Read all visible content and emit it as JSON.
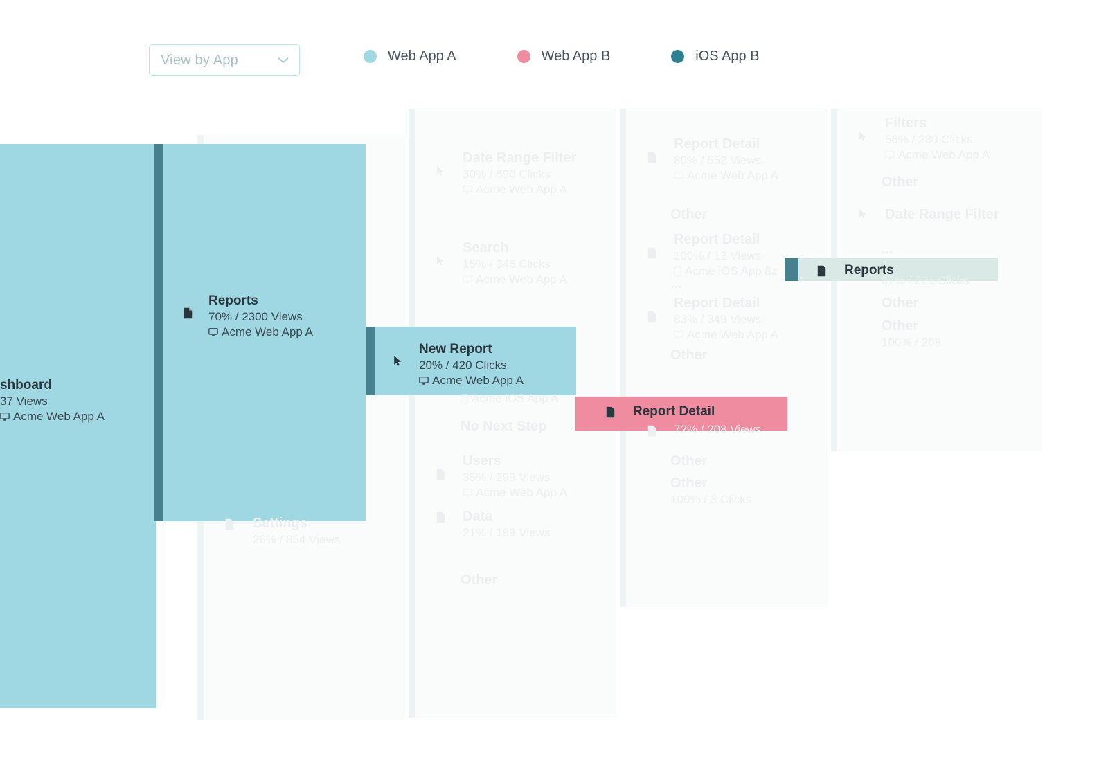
{
  "toolbar": {
    "view_select": {
      "value": "View by App",
      "icon": "chevron-down-icon"
    },
    "legend": [
      {
        "label": "Web App A",
        "color": "#9fd8e2",
        "icon": "legend-dot"
      },
      {
        "label": "Web App B",
        "color": "#ef8ca0",
        "icon": "legend-dot"
      },
      {
        "label": "iOS App B",
        "color": "#2f7f92",
        "icon": "legend-dot"
      }
    ]
  },
  "colors": {
    "flow_web_app_a": "#9fd8e2",
    "flow_web_app_b": "#ef8ca0",
    "flow_ios_app_b": "#2f7f92",
    "connector_bar": "#47818f",
    "highlight_mint": "#d8e9e6",
    "faded_text": "#eceff0",
    "panel_bg": "#fafbfb"
  },
  "flow": {
    "columns": [
      {
        "id": "col-1",
        "nodes": [
          {
            "name": "dashboard",
            "title": "shboard",
            "metric": "37 Views",
            "app": "Acme Web App A",
            "icon": "page-icon",
            "app_icon": "monitor-icon",
            "state": "highlight",
            "color": "#9fd8e2"
          }
        ]
      },
      {
        "id": "col-2",
        "nodes": [
          {
            "name": "reports",
            "title": "Reports",
            "metric": "70% / 2300 Views",
            "app": "Acme Web App A",
            "icon": "page-icon",
            "app_icon": "monitor-icon",
            "state": "highlight",
            "color": "#9fd8e2"
          },
          {
            "name": "settings",
            "title": "Settings",
            "metric": "26% / 854 Views",
            "app": "",
            "icon": "page-icon",
            "app_icon": "",
            "state": "faded"
          }
        ]
      },
      {
        "id": "col-3",
        "nodes": [
          {
            "name": "date-range-filter",
            "title": "Date Range Filter",
            "metric": "30% / 690 Clicks",
            "app": "Acme Web App A",
            "icon": "cursor-icon",
            "app_icon": "monitor-icon",
            "state": "faded"
          },
          {
            "name": "search",
            "title": "Search",
            "metric": "15% / 345 Clicks",
            "app": "Acme Web App A",
            "icon": "cursor-icon",
            "app_icon": "monitor-icon",
            "state": "faded"
          },
          {
            "name": "new-report",
            "title": "New Report",
            "metric": "20% / 420 Clicks",
            "app": "Acme Web App A",
            "icon": "cursor-icon",
            "app_icon": "monitor-icon",
            "state": "highlight",
            "color": "#9fd8e2"
          },
          {
            "name": "acme-ios-app-a",
            "title": "",
            "metric": "",
            "app": "Acme iOS App A",
            "icon": "",
            "app_icon": "mobile-icon",
            "state": "faded"
          },
          {
            "name": "no-next-step",
            "title": "No Next Step",
            "metric": "",
            "app": "",
            "icon": "",
            "app_icon": "",
            "state": "faded"
          },
          {
            "name": "users",
            "title": "Users",
            "metric": "35% / 299 Views",
            "app": "Acme Web App A",
            "icon": "page-icon",
            "app_icon": "monitor-icon",
            "state": "faded"
          },
          {
            "name": "data",
            "title": "Data",
            "metric": "21% / 189 Views",
            "app": "",
            "icon": "page-icon",
            "app_icon": "",
            "state": "faded"
          },
          {
            "name": "other-col3",
            "title": "Other",
            "metric": "",
            "app": "",
            "icon": "",
            "app_icon": "",
            "state": "faded"
          }
        ]
      },
      {
        "id": "col-4",
        "nodes": [
          {
            "name": "report-detail-552",
            "title": "Report Detail",
            "metric": "80% / 552 Views",
            "app": "Acme Web App A",
            "icon": "page-icon",
            "app_icon": "monitor-icon",
            "state": "faded"
          },
          {
            "name": "other-col4-a",
            "title": "Other",
            "metric": "",
            "app": "",
            "icon": "",
            "app_icon": "",
            "state": "faded"
          },
          {
            "name": "report-detail-12",
            "title": "Report Detail",
            "metric": "100% / 12 Views",
            "app": "Acme iOS App 8z",
            "icon": "page-icon",
            "app_icon": "mobile-icon",
            "state": "faded"
          },
          {
            "name": "ellipsis-col4",
            "title": "...",
            "metric": "",
            "app": "",
            "icon": "",
            "app_icon": "",
            "state": "faded"
          },
          {
            "name": "report-detail-349",
            "title": "Report Detail",
            "metric": "83% / 349 Views",
            "app": "Acme Web App A",
            "icon": "page-icon",
            "app_icon": "monitor-icon",
            "state": "faded"
          },
          {
            "name": "other-col4-b",
            "title": "Other",
            "metric": "",
            "app": "",
            "icon": "",
            "app_icon": "",
            "state": "faded"
          },
          {
            "name": "report-detail-highlight",
            "title": "Report Detail",
            "metric": "",
            "app": "",
            "icon": "page-icon",
            "app_icon": "",
            "state": "highlight",
            "color": "#ef8ca0"
          },
          {
            "name": "report-detail-208",
            "title": "",
            "metric": "72% / 208 Views",
            "app": "",
            "icon": "page-icon",
            "app_icon": "",
            "state": "faded"
          },
          {
            "name": "other-col4-c",
            "title": "Other",
            "metric": "",
            "app": "",
            "icon": "",
            "app_icon": "",
            "state": "faded"
          },
          {
            "name": "other-col4-d",
            "title": "Other",
            "metric": "100% / 3 Clicks",
            "app": "",
            "icon": "",
            "app_icon": "",
            "state": "faded"
          }
        ]
      },
      {
        "id": "col-5",
        "nodes": [
          {
            "name": "filters",
            "title": "Filters",
            "metric": "56% / 280 Clicks",
            "app": "Acme Web App A",
            "icon": "cursor-icon",
            "app_icon": "monitor-icon",
            "state": "faded"
          },
          {
            "name": "other-col5-a",
            "title": "Other",
            "metric": "",
            "app": "",
            "icon": "",
            "app_icon": "",
            "state": "faded"
          },
          {
            "name": "date-range-filter-col5",
            "title": "Date Range Filter",
            "metric": "",
            "app": "",
            "icon": "cursor-icon",
            "app_icon": "",
            "state": "faded"
          },
          {
            "name": "ellipsis-col5",
            "title": "...",
            "metric": "",
            "app": "",
            "icon": "",
            "app_icon": "",
            "state": "faded"
          },
          {
            "name": "reports-highlight",
            "title": "Reports",
            "metric": "",
            "app": "",
            "icon": "page-icon",
            "app_icon": "",
            "state": "highlight",
            "color": "#d8e9e6"
          },
          {
            "name": "reports-clicks",
            "title": "",
            "metric": "67% / 221 Clicks",
            "app": "",
            "icon": "",
            "app_icon": "",
            "state": "faded"
          },
          {
            "name": "other-col5-b",
            "title": "Other",
            "metric": "",
            "app": "",
            "icon": "",
            "app_icon": "",
            "state": "faded"
          },
          {
            "name": "other-col5-c",
            "title": "Other",
            "metric": "100% / 208",
            "app": "",
            "icon": "",
            "app_icon": "",
            "state": "faded"
          }
        ]
      }
    ]
  }
}
